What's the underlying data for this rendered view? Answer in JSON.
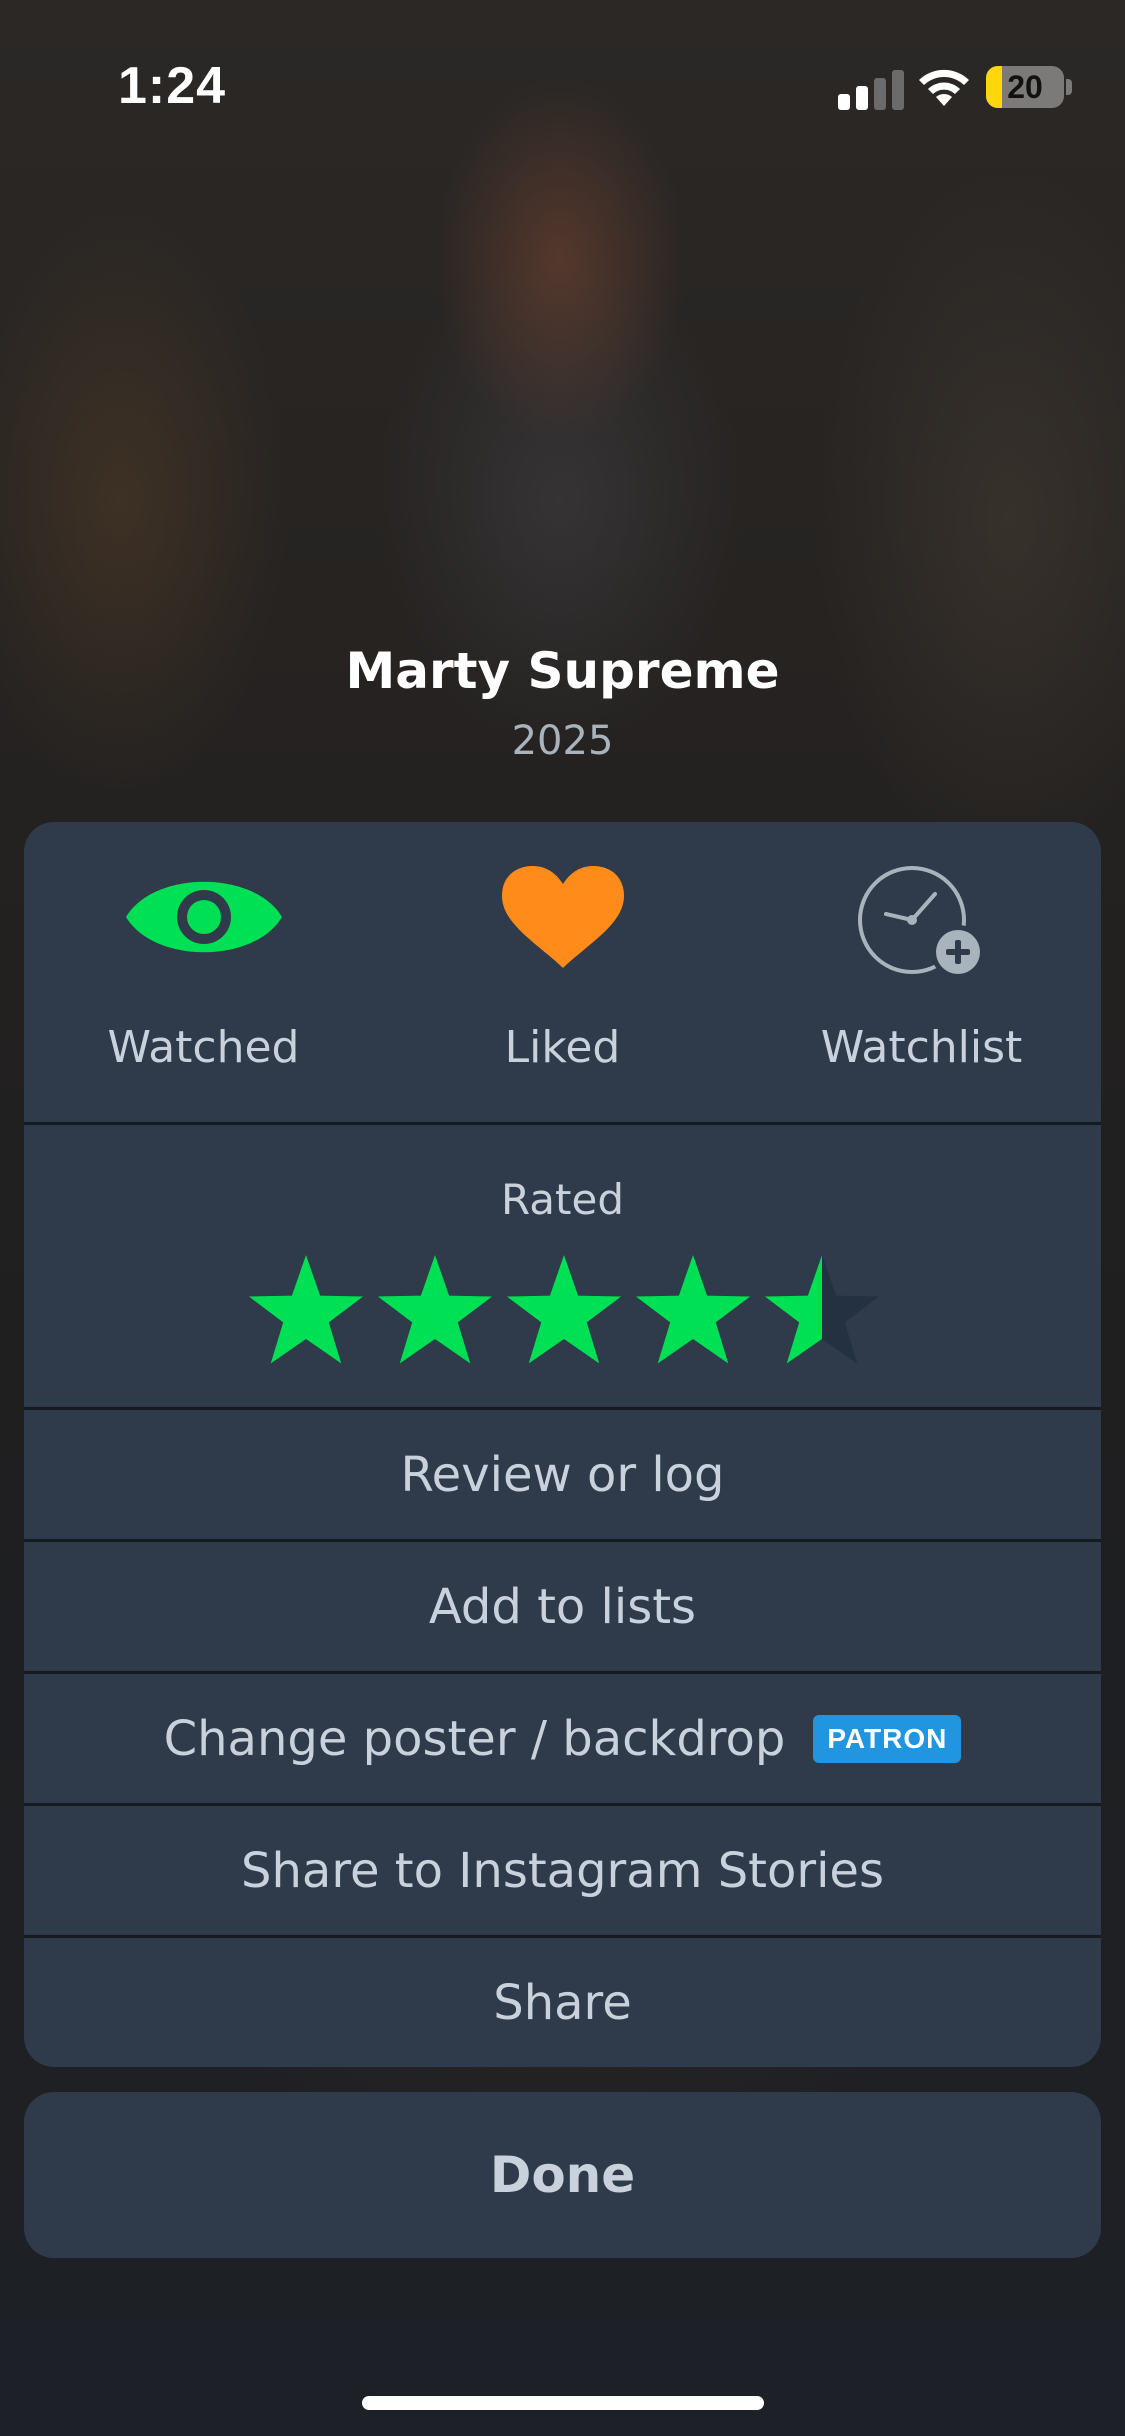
{
  "status_bar": {
    "time": "1:24",
    "battery_level": "20",
    "battery_fraction": 0.2,
    "battery_color": "#ffd60a",
    "signal_bars_active": 2,
    "signal_bars_total": 4,
    "icons": [
      "cellular-signal-icon",
      "wifi-icon",
      "battery-icon"
    ]
  },
  "film": {
    "title": "Marty Supreme",
    "year": "2025"
  },
  "actions": [
    {
      "label": "Watched",
      "icon": "eye-icon",
      "active": true,
      "color": "#00e054"
    },
    {
      "label": "Liked",
      "icon": "heart-icon",
      "active": true,
      "color": "#ff8c1a"
    },
    {
      "label": "Watchlist",
      "icon": "clock-plus-icon",
      "active": false,
      "color": "#c9d2dc"
    }
  ],
  "rating": {
    "label": "Rated",
    "value": 4.5,
    "max": 5,
    "star_color": "#00e054",
    "empty_star_color": "#243140"
  },
  "menu": {
    "review": "Review or log",
    "add_to_lists": "Add to lists",
    "change_poster": "Change poster / backdrop",
    "patron_badge": "PATRON",
    "share_instagram": "Share to Instagram Stories",
    "share": "Share"
  },
  "done_label": "Done",
  "colors": {
    "sheet": "#2f3a4a",
    "divider": "#161b22",
    "text": "#c9d2dc",
    "accent_green": "#00e054",
    "accent_orange": "#ff8c1a",
    "patron_blue": "#2295e0"
  }
}
